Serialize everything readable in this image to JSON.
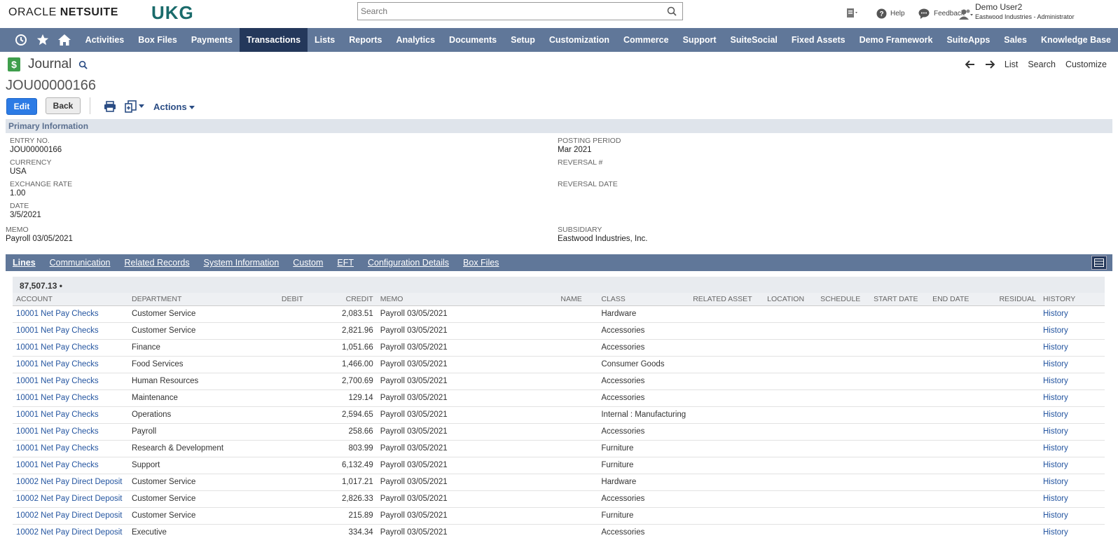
{
  "header": {
    "oracle_logo": "ORACLE",
    "netsuite_logo": "NETSUITE",
    "ukg_logo": "UKG",
    "search_placeholder": "Search",
    "help": "Help",
    "feedback": "Feedback",
    "user_name": "Demo User2",
    "user_role": "Eastwood Industries - Administrator"
  },
  "nav": {
    "items": [
      "Activities",
      "Box Files",
      "Payments",
      "Transactions",
      "Lists",
      "Reports",
      "Analytics",
      "Documents",
      "Setup",
      "Customization",
      "Commerce",
      "Support",
      "SuiteSocial",
      "Fixed Assets",
      "Demo Framework",
      "SuiteApps",
      "Sales",
      "Knowledge Base"
    ],
    "active": "Transactions"
  },
  "page": {
    "title": "Journal",
    "record_id": "JOU00000166",
    "links": {
      "list": "List",
      "search": "Search",
      "customize": "Customize"
    }
  },
  "toolbar": {
    "edit": "Edit",
    "back": "Back",
    "actions": "Actions"
  },
  "primary": {
    "section_title": "Primary Information",
    "entry_no_label": "ENTRY NO.",
    "entry_no": "JOU00000166",
    "currency_label": "CURRENCY",
    "currency": "USA",
    "exchange_rate_label": "EXCHANGE RATE",
    "exchange_rate": "1.00",
    "date_label": "DATE",
    "date": "3/5/2021",
    "memo_label": "MEMO",
    "memo": "Payroll 03/05/2021",
    "posting_period_label": "POSTING PERIOD",
    "posting_period": "Mar 2021",
    "reversal_no_label": "REVERSAL #",
    "reversal_date_label": "REVERSAL DATE",
    "subsidiary_label": "SUBSIDIARY",
    "subsidiary": "Eastwood Industries, Inc."
  },
  "tabs": [
    "Lines",
    "Communication",
    "Related Records",
    "System Information",
    "Custom",
    "EFT",
    "Configuration Details",
    "Box Files"
  ],
  "lines": {
    "total": "87,507.13 •",
    "columns": [
      "ACCOUNT",
      "DEPARTMENT",
      "DEBIT",
      "CREDIT",
      "MEMO",
      "NAME",
      "CLASS",
      "RELATED ASSET",
      "LOCATION",
      "SCHEDULE",
      "START DATE",
      "END DATE",
      "RESIDUAL",
      "HISTORY"
    ],
    "rows": [
      {
        "account": "10001 Net Pay Checks",
        "department": "Customer Service",
        "credit": "2,083.51",
        "memo": "Payroll 03/05/2021",
        "class": "Hardware",
        "history": "History"
      },
      {
        "account": "10001 Net Pay Checks",
        "department": "Customer Service",
        "credit": "2,821.96",
        "memo": "Payroll 03/05/2021",
        "class": "Accessories",
        "history": "History"
      },
      {
        "account": "10001 Net Pay Checks",
        "department": "Finance",
        "credit": "1,051.66",
        "memo": "Payroll 03/05/2021",
        "class": "Accessories",
        "history": "History"
      },
      {
        "account": "10001 Net Pay Checks",
        "department": "Food Services",
        "credit": "1,466.00",
        "memo": "Payroll 03/05/2021",
        "class": "Consumer Goods",
        "history": "History"
      },
      {
        "account": "10001 Net Pay Checks",
        "department": "Human Resources",
        "credit": "2,700.69",
        "memo": "Payroll 03/05/2021",
        "class": "Accessories",
        "history": "History"
      },
      {
        "account": "10001 Net Pay Checks",
        "department": "Maintenance",
        "credit": "129.14",
        "memo": "Payroll 03/05/2021",
        "class": "Accessories",
        "history": "History"
      },
      {
        "account": "10001 Net Pay Checks",
        "department": "Operations",
        "credit": "2,594.65",
        "memo": "Payroll 03/05/2021",
        "class": "Internal : Manufacturing",
        "history": "History"
      },
      {
        "account": "10001 Net Pay Checks",
        "department": "Payroll",
        "credit": "258.66",
        "memo": "Payroll 03/05/2021",
        "class": "Accessories",
        "history": "History"
      },
      {
        "account": "10001 Net Pay Checks",
        "department": "Research & Development",
        "credit": "803.99",
        "memo": "Payroll 03/05/2021",
        "class": "Furniture",
        "history": "History"
      },
      {
        "account": "10001 Net Pay Checks",
        "department": "Support",
        "credit": "6,132.49",
        "memo": "Payroll 03/05/2021",
        "class": "Furniture",
        "history": "History"
      },
      {
        "account": "10002 Net Pay Direct Deposit",
        "department": "Customer Service",
        "credit": "1,017.21",
        "memo": "Payroll 03/05/2021",
        "class": "Hardware",
        "history": "History"
      },
      {
        "account": "10002 Net Pay Direct Deposit",
        "department": "Customer Service",
        "credit": "2,826.33",
        "memo": "Payroll 03/05/2021",
        "class": "Accessories",
        "history": "History"
      },
      {
        "account": "10002 Net Pay Direct Deposit",
        "department": "Customer Service",
        "credit": "215.89",
        "memo": "Payroll 03/05/2021",
        "class": "Furniture",
        "history": "History"
      },
      {
        "account": "10002 Net Pay Direct Deposit",
        "department": "Executive",
        "credit": "334.34",
        "memo": "Payroll 03/05/2021",
        "class": "Accessories",
        "history": "History"
      }
    ]
  }
}
